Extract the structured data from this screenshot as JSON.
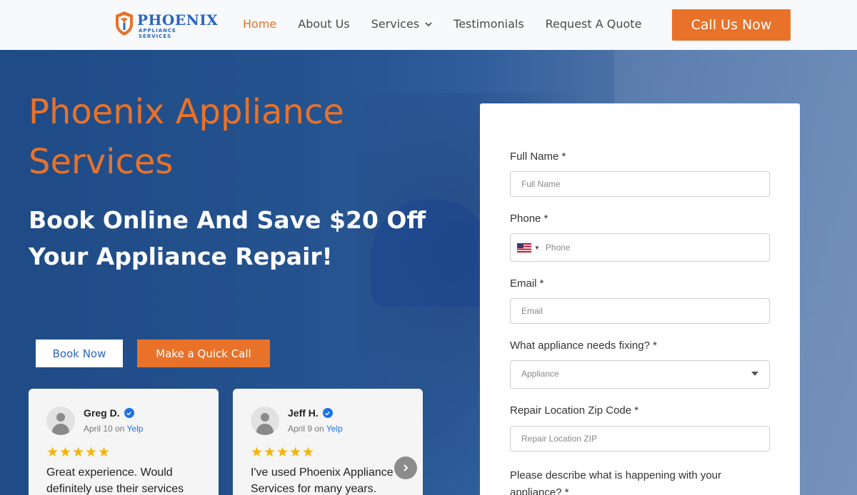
{
  "header": {
    "logo_title": "PHOENIX",
    "logo_subtitle": "APPLIANCE SERVICES",
    "nav": [
      "Home",
      "About Us",
      "Services",
      "Testimonials",
      "Request A Quote"
    ],
    "active_nav": "Home",
    "call_label": "Call Us Now"
  },
  "hero": {
    "title": "Phoenix Appliance Services",
    "subtitle": "Book Online And Save $20 Off Your Appliance Repair!",
    "book_label": "Book Now",
    "call_label": "Make a Quick Call"
  },
  "reviews": [
    {
      "name": "Greg D.",
      "date": "April 10",
      "on": "on",
      "source": "Yelp",
      "stars": 5,
      "text": "Great experience. Would definitely use their services"
    },
    {
      "name": "Jeff H.",
      "date": "April 9",
      "on": "on",
      "source": "Yelp",
      "stars": 5,
      "text": "I've used Phoenix Appliance Services for many years."
    }
  ],
  "form": {
    "full_name_label": "Full Name *",
    "full_name_placeholder": "Full Name",
    "phone_label": "Phone *",
    "phone_placeholder": "Phone",
    "email_label": "Email *",
    "email_placeholder": "Email",
    "appliance_label": "What appliance needs fixing? *",
    "appliance_placeholder": "Appliance",
    "zip_label": "Repair Location Zip Code *",
    "zip_placeholder": "Repair Location ZIP",
    "describe_label": "Please describe what is happening with your appliance? *"
  },
  "colors": {
    "accent": "#e8722a",
    "brand_blue": "#2a66c0",
    "star": "#f5b400"
  }
}
